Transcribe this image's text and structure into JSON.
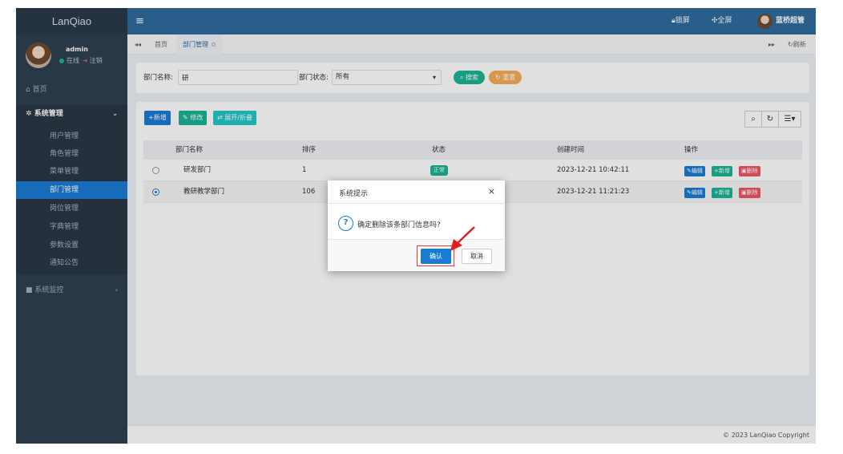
{
  "app": {
    "logo": "LanQiao"
  },
  "user": {
    "name": "admin",
    "status": "在线",
    "logout": "注销"
  },
  "topbar": {
    "menu_icon": "hamburger-icon",
    "lock": "锁屏",
    "fullscreen": "全屏",
    "user_name": "蓝桥超管"
  },
  "sidebar": {
    "home": "首页",
    "system": "系统管理",
    "items": [
      {
        "label": "用户管理"
      },
      {
        "label": "角色管理"
      },
      {
        "label": "菜单管理"
      },
      {
        "label": "部门管理",
        "active": true
      },
      {
        "label": "岗位管理"
      },
      {
        "label": "字典管理"
      },
      {
        "label": "参数设置"
      },
      {
        "label": "通知公告"
      }
    ],
    "monitor": "系统监控"
  },
  "tabs": {
    "nav_prev": "◂◂",
    "home": "首页",
    "active": "部门管理",
    "nav_next": "▸▸",
    "refresh": "刷新"
  },
  "search": {
    "dept_label": "部门名称:",
    "dept_value": "研",
    "status_label": "部门状态:",
    "status_value": "所有",
    "search_btn": "搜索",
    "reset_btn": "重置"
  },
  "toolbar": {
    "add": "新增",
    "edit": "修改",
    "expand": "展开/折叠"
  },
  "table": {
    "headers": [
      "部门名称",
      "排序",
      "状态",
      "创建时间",
      "操作"
    ],
    "rows": [
      {
        "name": "研发部门",
        "order": "1",
        "status": "正常",
        "created": "2023-12-21 10:42:11",
        "selected": false
      },
      {
        "name": "教研教学部门",
        "order": "106",
        "status": "",
        "created": "2023-12-21 11:21:23",
        "selected": true
      }
    ],
    "ops": {
      "edit": "编辑",
      "add": "新增",
      "delete": "删除"
    }
  },
  "dialog": {
    "title": "系统提示",
    "close": "×",
    "message": "确定删除该条部门信息吗?",
    "confirm": "确认",
    "cancel": "取消"
  },
  "footer": {
    "copyright": "© 2023 LanQiao Copyright"
  },
  "colors": {
    "primary": "#1a7bd3",
    "success": "#1ab394",
    "danger": "#ed5565",
    "warning": "#f8ac59",
    "topbar": "#2f6b9e",
    "sidebar": "#2f4050"
  }
}
